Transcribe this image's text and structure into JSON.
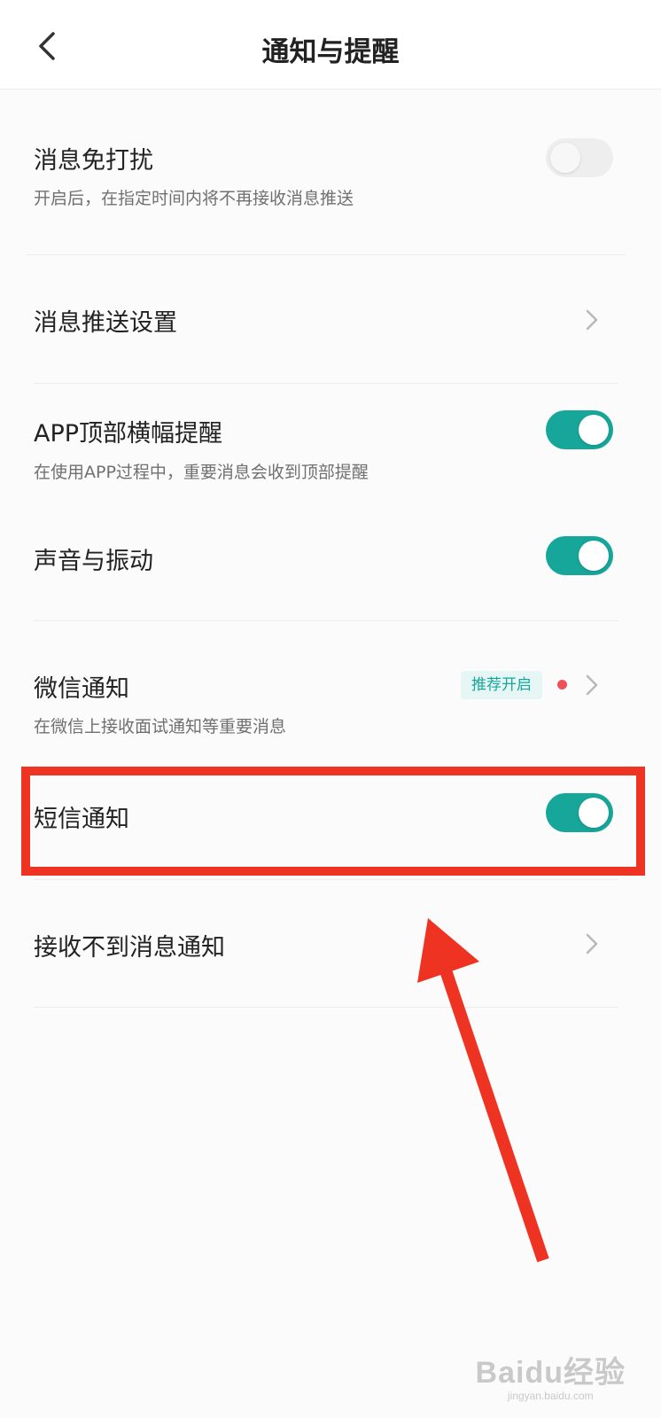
{
  "header": {
    "title": "通知与提醒",
    "back_icon": "chevron-left-icon"
  },
  "items": [
    {
      "title": "消息免打扰",
      "subtitle": "开启后，在指定时间内将不再接收消息推送",
      "control": "toggle",
      "checked": false
    },
    {
      "title": "消息推送设置",
      "control": "chevron"
    },
    {
      "title": "APP顶部横幅提醒",
      "subtitle": "在使用APP过程中，重要消息会收到顶部提醒",
      "control": "toggle",
      "checked": true
    },
    {
      "title": "声音与振动",
      "control": "toggle",
      "checked": true
    },
    {
      "title": "微信通知",
      "subtitle": "在微信上接收面试通知等重要消息",
      "control": "chevron",
      "badge": "推荐开启",
      "dot": true
    },
    {
      "title": "短信通知",
      "control": "toggle",
      "checked": true
    },
    {
      "title": "接收不到消息通知",
      "control": "chevron"
    }
  ],
  "colors": {
    "accent": "#17a69a",
    "badge_bg": "#e6f6f4",
    "red_dot": "#f0505a",
    "annotation": "#ee3322"
  },
  "watermark": {
    "main": "Baidu经验",
    "sub": "jingyan.baidu.com"
  }
}
